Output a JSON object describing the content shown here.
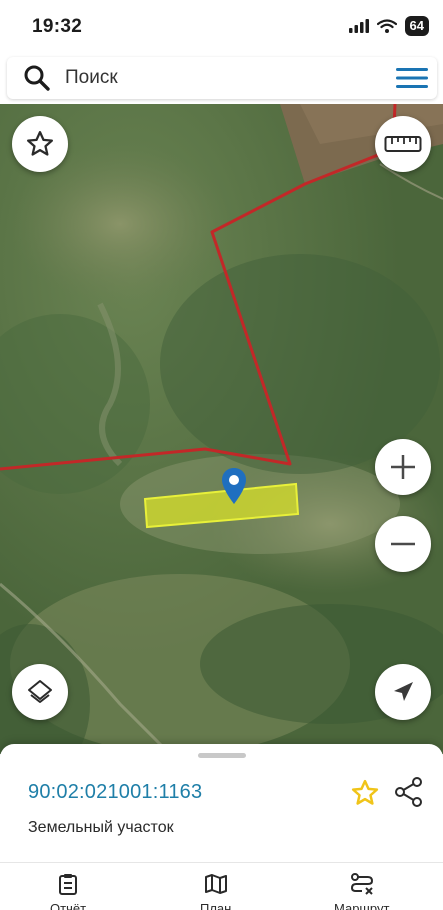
{
  "status_bar": {
    "time": "19:32",
    "battery": "64",
    "icons": [
      "signal-icon",
      "wifi-icon",
      "battery-icon"
    ]
  },
  "search": {
    "placeholder": "Поиск",
    "icons": [
      "search-icon",
      "menu-icon"
    ]
  },
  "map": {
    "controls": [
      "favorite-star-icon",
      "ruler-icon",
      "zoom-in-icon",
      "zoom-out-icon",
      "layers-icon",
      "navigation-arrow-icon"
    ],
    "colors": {
      "boundary": "#c22828",
      "parcel_fill": "#d8e02a",
      "marker": "#1f6fc0"
    }
  },
  "sheet": {
    "cadastral_number": "90:02:021001:1163",
    "parcel_type": "Земельный участок",
    "icons": [
      "favorite-star-icon",
      "share-icon"
    ],
    "accent": "#1f7fa8",
    "star_color": "#f0c419"
  },
  "tabs": [
    {
      "label": "Отчёт",
      "icon": "report-icon"
    },
    {
      "label": "План",
      "icon": "map-plan-icon"
    },
    {
      "label": "Маршрут",
      "icon": "route-icon"
    }
  ]
}
